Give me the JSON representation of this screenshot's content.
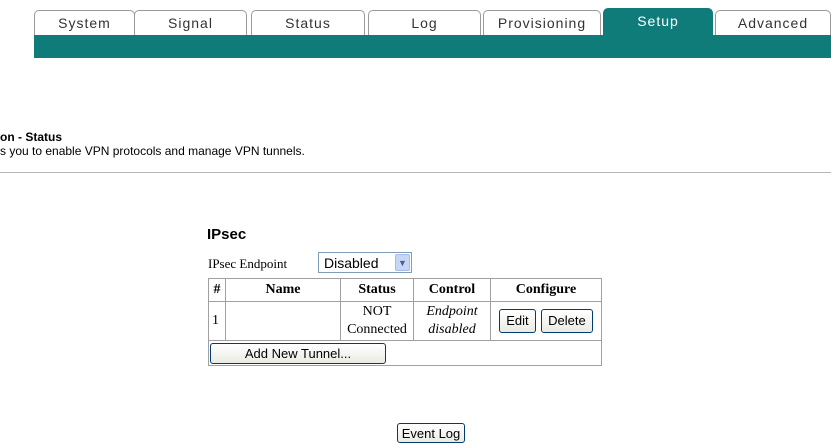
{
  "tabs": [
    {
      "label": "System",
      "active": false
    },
    {
      "label": "Signal",
      "active": false
    },
    {
      "label": "Status",
      "active": false
    },
    {
      "label": "Log",
      "active": false
    },
    {
      "label": "Provisioning",
      "active": false
    },
    {
      "label": "Setup",
      "active": true
    },
    {
      "label": "Advanced",
      "active": false
    }
  ],
  "header": {
    "title": "on - Status",
    "description": "s you to enable VPN protocols and manage VPN tunnels."
  },
  "ipsec": {
    "title": "IPsec",
    "endpoint_label": "IPsec Endpoint",
    "endpoint_value": "Disabled",
    "columns": [
      "#",
      "Name",
      "Status",
      "Control",
      "Configure"
    ],
    "rows": [
      {
        "num": "1",
        "name": "",
        "status_line1": "NOT",
        "status_line2": "Connected",
        "control_line1": "Endpoint",
        "control_line2": "disabled",
        "edit_label": "Edit",
        "delete_label": "Delete"
      }
    ],
    "add_tunnel_label": "Add New Tunnel..."
  },
  "event_log_label": "Event Log",
  "colors": {
    "accent": "#0f7c7a",
    "tab_text": "#333333"
  }
}
